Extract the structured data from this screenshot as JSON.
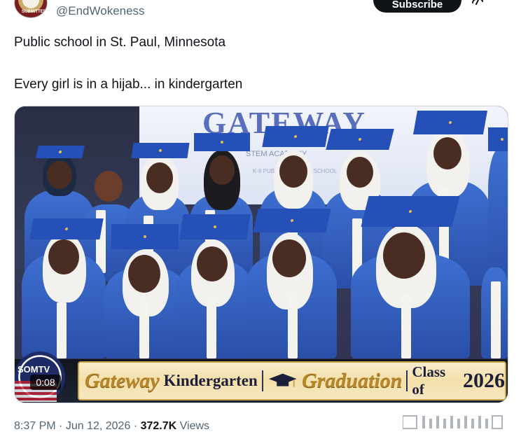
{
  "header": {
    "handle": "@EndWokeness",
    "subscribe_label": "Subscribe",
    "avatar_text": "SUBMITTED"
  },
  "post": {
    "line1": "Public school in St. Paul, Minnesota",
    "line2": "Every girl is in a hijab... in kindergarten"
  },
  "media": {
    "screen_title": "GATEWAY",
    "screen_sub": "STEM ACADEMY",
    "screen_sub2": "K-8 PUBLIC CHARTER SCHOOL",
    "channel": "SOMTV",
    "duration": "0:08",
    "banner": {
      "word1": "Gateway",
      "word2": "Kindergarten",
      "word3": "Graduation",
      "class_label": "Class of",
      "year": "2026"
    }
  },
  "meta": {
    "time": "8:37 PM",
    "separator": "·",
    "date": "Jun 12, 2026",
    "views_count": "372.7K",
    "views_label": "Views"
  },
  "icons": {
    "avatar": "seal-avatar-icon",
    "grok": "grok-icon",
    "graduation_cap": "graduation-cap-icon"
  },
  "colors": {
    "text": "#0f1419",
    "muted": "#536471",
    "gown_blue": "#2a4fa8",
    "banner_gold": "#c9a248"
  }
}
